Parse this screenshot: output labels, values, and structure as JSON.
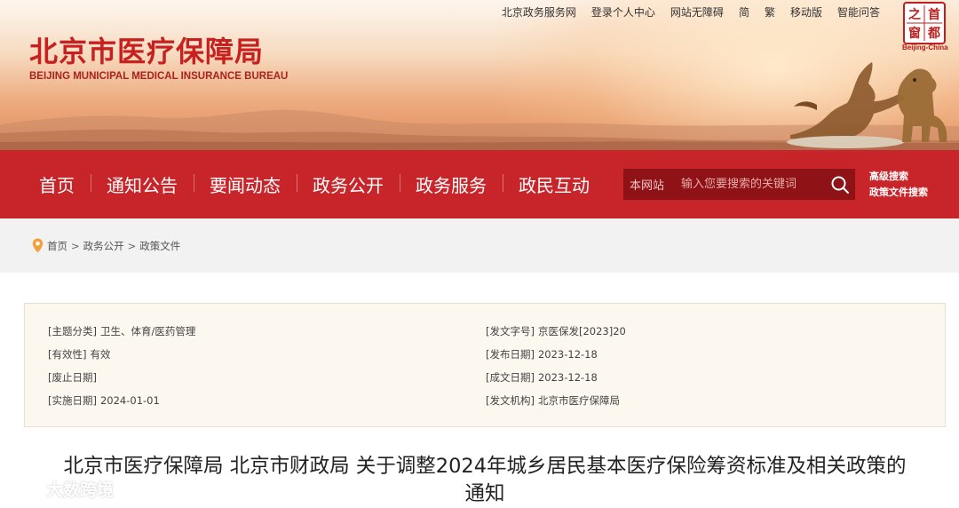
{
  "header": {
    "logo_cn": "北京市医疗保障局",
    "logo_en": "BEIJING MUNICIPAL MEDICAL INSURANCE BUREAU",
    "top_links": [
      "北京政务服务网",
      "登录个人中心",
      "网站无障碍",
      "简",
      "繁",
      "移动版",
      "智能问答"
    ],
    "seal_text": [
      "首",
      "都",
      "之",
      "窗"
    ],
    "seal_sub": "Beijing-China"
  },
  "nav": {
    "items": [
      "首页",
      "通知公告",
      "要闻动态",
      "政务公开",
      "政务服务",
      "政民互动"
    ],
    "search_scope": "本网站",
    "search_placeholder": "输入您要搜索的关键词",
    "advanced_search": "高级搜索",
    "policy_search": "政策文件搜索"
  },
  "breadcrumb": [
    "首页",
    "政务公开",
    "政策文件"
  ],
  "info": {
    "left": [
      {
        "label": "[主题分类]",
        "value": "卫生、体育/医药管理"
      },
      {
        "label": "[有效性]",
        "value": "有效"
      },
      {
        "label": "[废止日期]",
        "value": ""
      },
      {
        "label": "[实施日期]",
        "value": "2024-01-01"
      }
    ],
    "right": [
      {
        "label": "[发文字号]",
        "value": "京医保发[2023]20"
      },
      {
        "label": "[发布日期]",
        "value": "2023-12-18"
      },
      {
        "label": "[成文日期]",
        "value": "2023-12-18"
      },
      {
        "label": "[发文机构]",
        "value": "北京市医疗保障局"
      }
    ]
  },
  "title": {
    "line1": "北京市医疗保障局 北京市财政局 关于调整2024年城乡居民基本医疗保险筹资标准及相关政策的",
    "line2": "通知"
  },
  "watermark": "大数跨境",
  "colors": {
    "nav_red": "#c8252a",
    "logo_red": "#c8201f",
    "search_dark": "#8e1216",
    "info_bg": "#fcf7ef"
  }
}
